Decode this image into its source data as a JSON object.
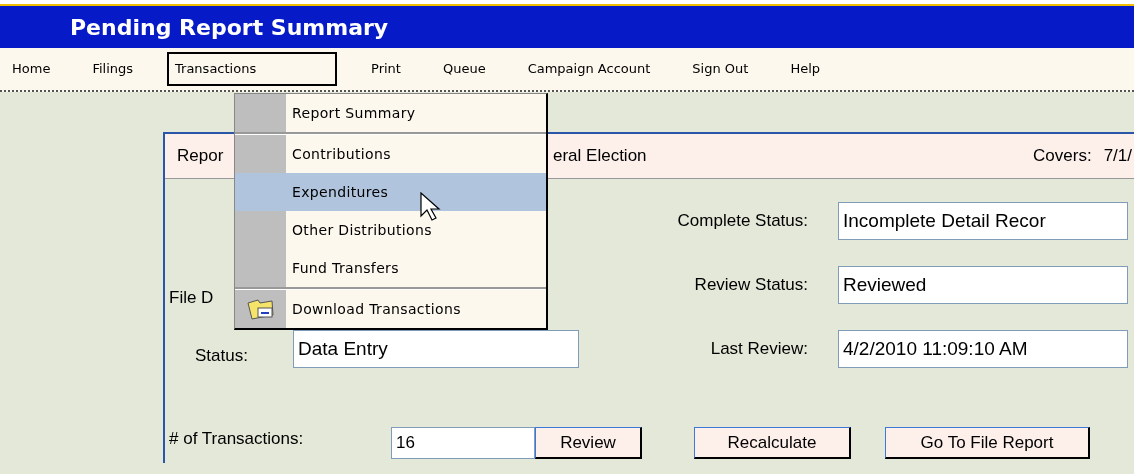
{
  "window": {
    "title": "Pending Report Summary"
  },
  "menu": [
    {
      "label": "Home",
      "selected": false
    },
    {
      "label": "Filings",
      "selected": false
    },
    {
      "label": "Transactions",
      "selected": true
    },
    {
      "label": "Print",
      "selected": false
    },
    {
      "label": "Queue",
      "selected": false
    },
    {
      "label": "Campaign Account",
      "selected": false
    },
    {
      "label": "Sign Out",
      "selected": false
    },
    {
      "label": "Help",
      "selected": false
    }
  ],
  "dropdown": {
    "items": [
      {
        "label": "Report Summary",
        "selected": false,
        "kind": "plain",
        "separator_after": true
      },
      {
        "label": "Contributions",
        "selected": false,
        "kind": "plain",
        "separator_after": false
      },
      {
        "label": "Expenditures",
        "selected": true,
        "kind": "plain",
        "separator_after": false
      },
      {
        "label": "Other Distributions",
        "selected": false,
        "kind": "plain",
        "separator_after": false
      },
      {
        "label": "Fund Transfers",
        "selected": false,
        "kind": "plain",
        "separator_after": true
      },
      {
        "label": "Download Transactions",
        "selected": false,
        "kind": "download",
        "separator_after": false
      }
    ]
  },
  "report_header": {
    "name_start": "Repor",
    "name_end": "eral Election",
    "covers_label": "Covers:",
    "covers_value": "7/1/"
  },
  "file_date": {
    "label": "File D"
  },
  "status": {
    "label": "Status:",
    "value": "Data Entry"
  },
  "complete_status": {
    "label": "Complete Status:",
    "value": "Incomplete Detail Recor"
  },
  "review_status": {
    "label": "Review Status:",
    "value": "Reviewed"
  },
  "last_review": {
    "label": "Last Review:",
    "value": "4/2/2010 11:09:10 AM"
  },
  "transactions": {
    "label": "# of Transactions:",
    "value": "16"
  },
  "buttons": [
    "Review",
    "Recalculate",
    "Go To File Report"
  ]
}
